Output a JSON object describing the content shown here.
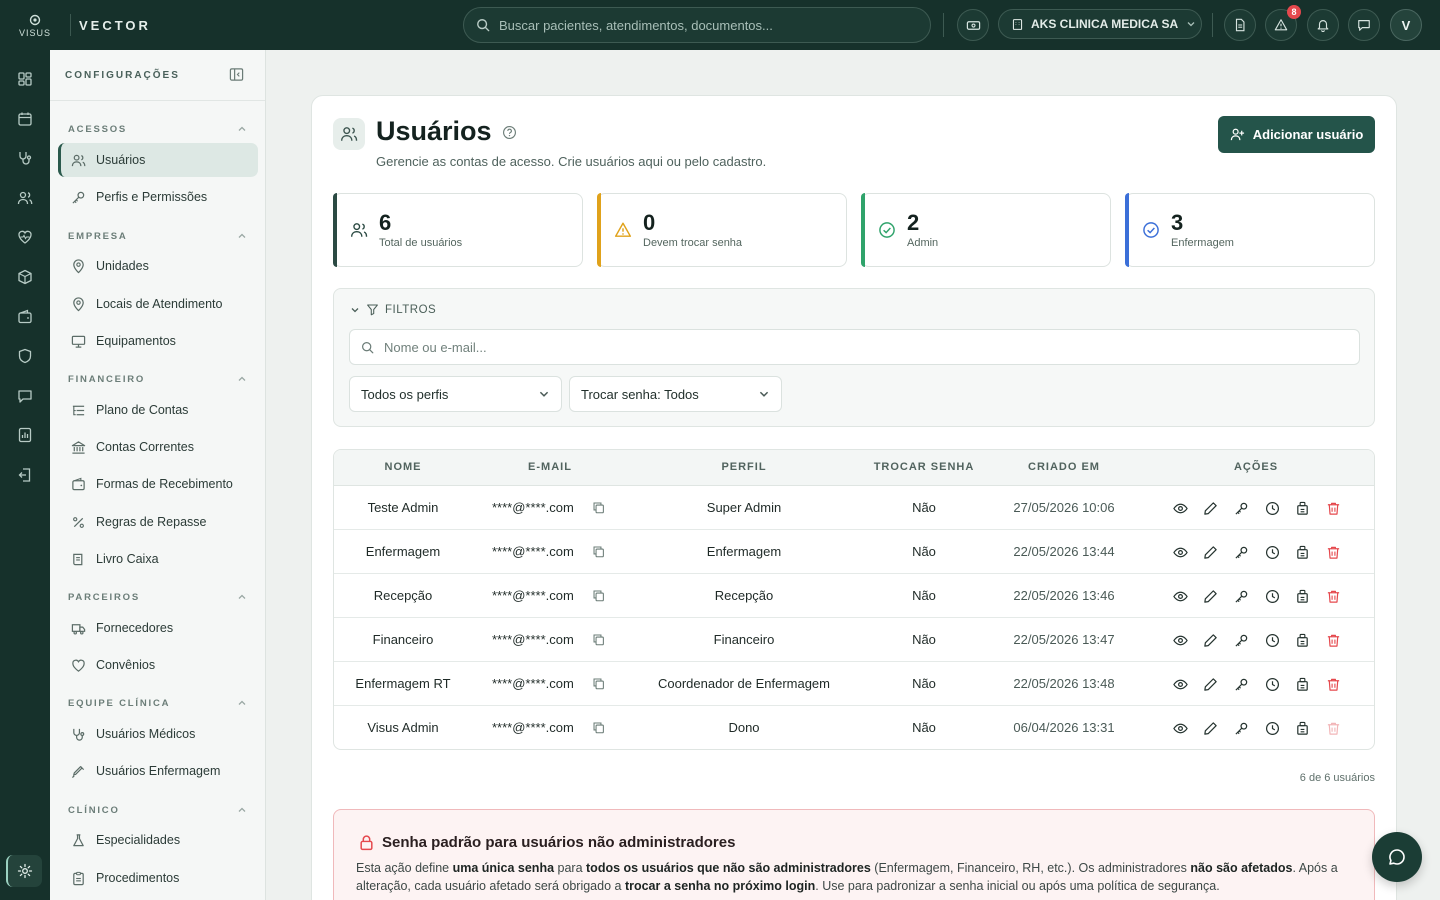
{
  "brand": {
    "logo_text": "VISUS",
    "name": "VECTOR"
  },
  "topbar": {
    "search_placeholder": "Buscar pacientes, atendimentos, documentos...",
    "clinic_name": "AKS CLINICA MEDICA SA",
    "alerts_badge": "8",
    "avatar_initial": "V"
  },
  "sidebar": {
    "title": "CONFIGURAÇÕES",
    "groups": {
      "acessos": "ACESSOS",
      "empresa": "EMPRESA",
      "financeiro": "FINANCEIRO",
      "parceiros": "PARCEIROS",
      "equipe": "EQUIPE CLÍNICA",
      "clinico": "CLÍNICO"
    },
    "items": {
      "usuarios": "Usuários",
      "perfis": "Perfis e Permissões",
      "unidades": "Unidades",
      "locais": "Locais de Atendimento",
      "equipamentos": "Equipamentos",
      "plano": "Plano de Contas",
      "contas": "Contas Correntes",
      "formas": "Formas de Recebimento",
      "regras": "Regras de Repasse",
      "livro": "Livro Caixa",
      "fornecedores": "Fornecedores",
      "convenios": "Convênios",
      "medicos": "Usuários Médicos",
      "enfermagem": "Usuários Enfermagem",
      "especialidades": "Especialidades",
      "procedimentos": "Procedimentos"
    }
  },
  "page": {
    "title": "Usuários",
    "subtitle": "Gerencie as contas de acesso. Crie usuários aqui ou pelo cadastro.",
    "add_button": "Adicionar usuário"
  },
  "stats": [
    {
      "value": "6",
      "label": "Total de usuários",
      "color": "#2b4a43"
    },
    {
      "value": "0",
      "label": "Devem trocar senha",
      "color": "#e0a21b"
    },
    {
      "value": "2",
      "label": "Admin",
      "color": "#2fa36b"
    },
    {
      "value": "3",
      "label": "Enfermagem",
      "color": "#3b6fd8"
    }
  ],
  "filters": {
    "title": "FILTROS",
    "search_placeholder": "Nome ou e-mail...",
    "profile_select": "Todos os perfis",
    "password_select": "Trocar senha: Todos"
  },
  "table": {
    "headers": {
      "name": "NOME",
      "email": "E-MAIL",
      "profile": "PERFIL",
      "change": "TROCAR SENHA",
      "created": "CRIADO EM",
      "actions": "AÇÕES"
    },
    "rows": [
      {
        "name": "Teste Admin",
        "email": "****@****.com",
        "profile": "Super Admin",
        "change": "Não",
        "created": "27/05/2026 10:06"
      },
      {
        "name": "Enfermagem",
        "email": "****@****.com",
        "profile": "Enfermagem",
        "change": "Não",
        "created": "22/05/2026 13:44"
      },
      {
        "name": "Recepção",
        "email": "****@****.com",
        "profile": "Recepção",
        "change": "Não",
        "created": "22/05/2026 13:46"
      },
      {
        "name": "Financeiro",
        "email": "****@****.com",
        "profile": "Financeiro",
        "change": "Não",
        "created": "22/05/2026 13:47"
      },
      {
        "name": "Enfermagem RT",
        "email": "****@****.com",
        "profile": "Coordenador de Enfermagem",
        "change": "Não",
        "created": "22/05/2026 13:48"
      },
      {
        "name": "Visus Admin",
        "email": "****@****.com",
        "profile": "Dono",
        "change": "Não",
        "created": "06/04/2026 13:31"
      }
    ],
    "count": "6 de 6 usuários"
  },
  "warning": {
    "title": "Senha padrão para usuários não administradores",
    "t1": "Esta ação define ",
    "b1": "uma única senha",
    "t2": " para ",
    "b2": "todos os usuários que não são administradores",
    "t3": " (Enfermagem, Financeiro, RH, etc.). Os administradores ",
    "b3": "não são afetados",
    "t4": ". Após a alteração, cada usuário afetado será obrigado a ",
    "b4": "trocar a senha no próximo login",
    "t5": ". Use para padronizar a senha inicial ou após uma política de segurança."
  }
}
